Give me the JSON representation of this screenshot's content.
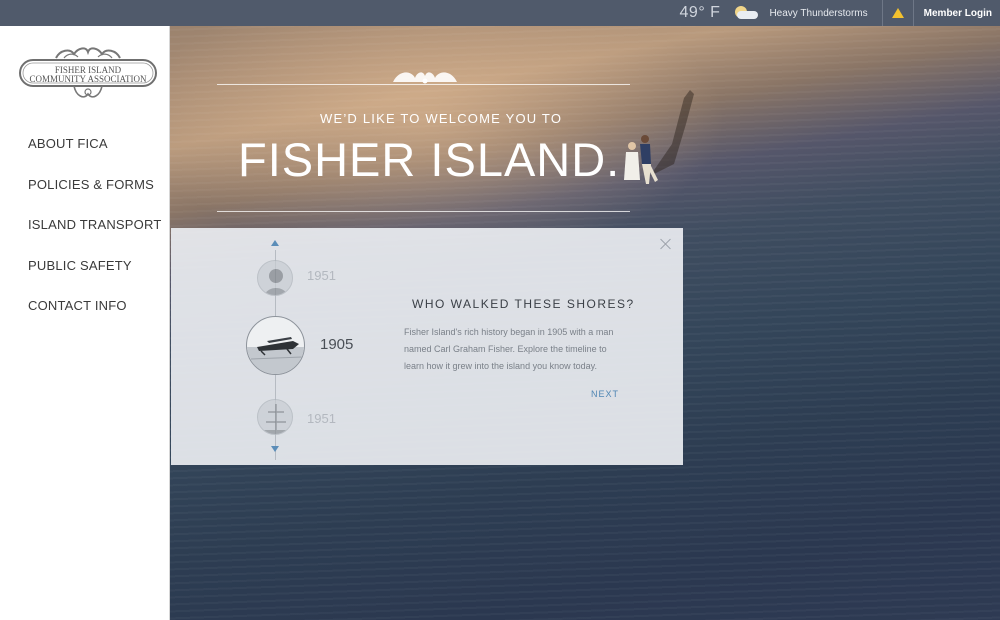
{
  "topbar": {
    "temperature": "49° F",
    "weather_icon": "cloudy-sun-icon",
    "condition": "Heavy Thunderstorms",
    "alert_icon": "warning-icon",
    "login_label": "Member Login"
  },
  "sidebar": {
    "logo_lines": [
      "FISHER ISLAND",
      "COMMUNITY ASSOCIATION"
    ],
    "items": [
      {
        "label": "ABOUT FICA"
      },
      {
        "label": "POLICIES & FORMS"
      },
      {
        "label": "ISLAND TRANSPORT"
      },
      {
        "label": "PUBLIC SAFETY"
      },
      {
        "label": "CONTACT INFO"
      }
    ]
  },
  "hero": {
    "subtitle": "WE’D LIKE TO WELCOME YOU TO",
    "title": "FISHER ISLAND."
  },
  "history": {
    "prev_year": "1951",
    "active_year": "1905",
    "next_year": "1951",
    "heading": "WHO WALKED THESE SHORES?",
    "body": "Fisher Island's rich history began in 1905 with a man named Carl Graham Fisher. Explore the timeline to learn how it grew into the island you know today.",
    "next_label": "NEXT"
  },
  "colors": {
    "topbar": "#505a6b",
    "accent": "#4f86b4",
    "alert": "#f3c12e"
  }
}
